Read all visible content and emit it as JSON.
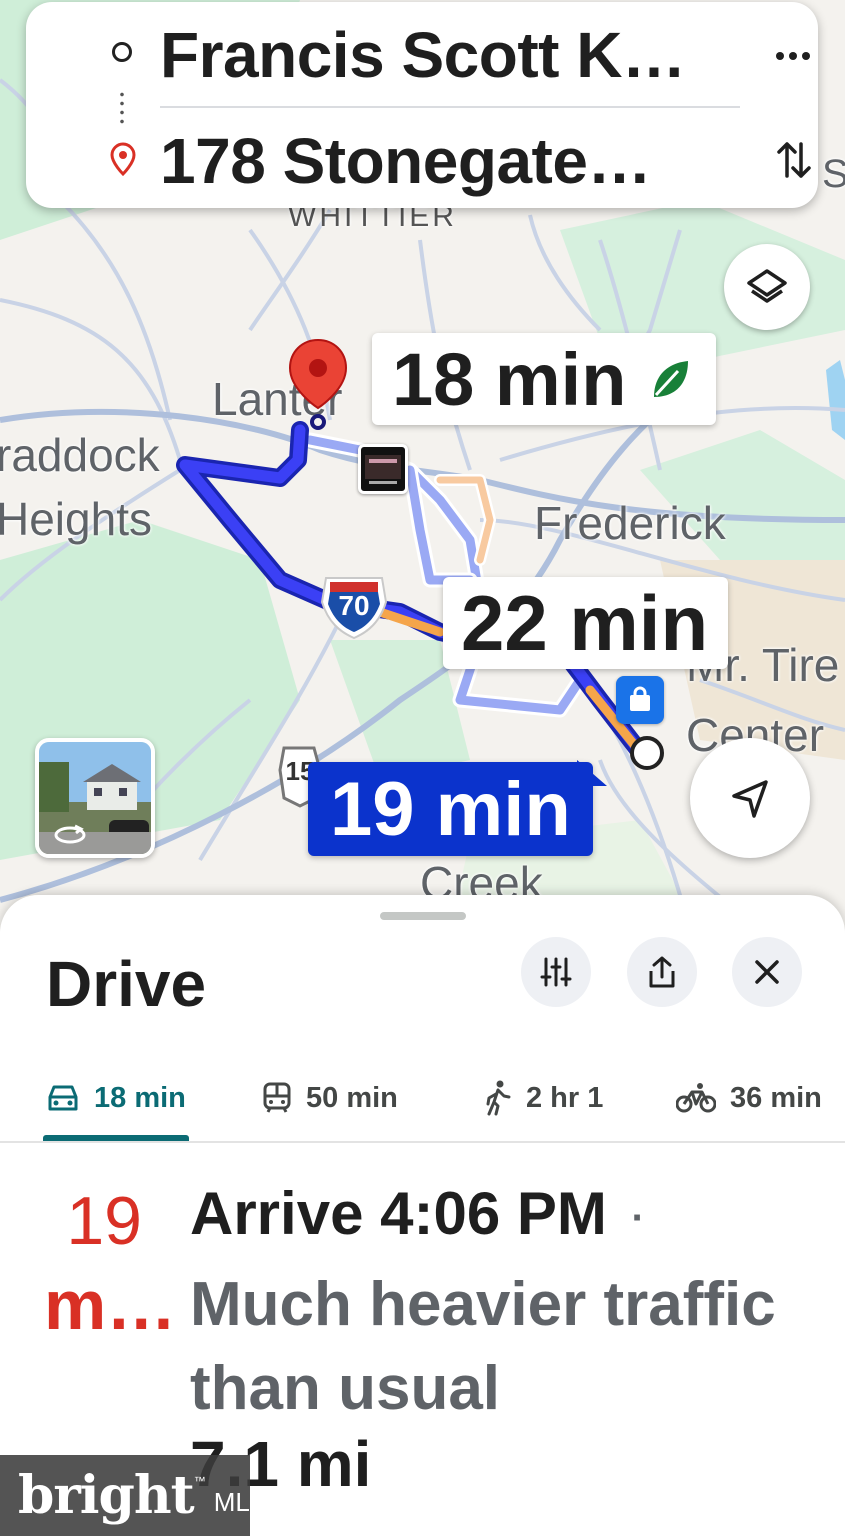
{
  "search": {
    "origin": "Francis Scott K…",
    "destination": "178 Stonegate…",
    "more_icon": "more-horiz-icon",
    "swap_icon": "swap-vert-icon"
  },
  "map": {
    "labels": {
      "whittier": "WHITTIER",
      "lantern": "Lanter",
      "braddock": "raddock",
      "heights": "Heights",
      "frederick": "Frederick",
      "mr_tire": "Mr. Tire",
      "center": "Center",
      "creek": "Creek",
      "edge_s": "S"
    },
    "shields": {
      "i70": "70",
      "us15": "15"
    },
    "route_times": {
      "best": "18 min",
      "alt1": "22 min",
      "selected": "19 min"
    },
    "colors": {
      "route_selected": "#2a36f0",
      "route_alt": "#9aa9f4",
      "traffic_slow": "#f5a54a",
      "label_selected_bg": "#0b33cc"
    }
  },
  "sheet": {
    "title": "Drive",
    "tabs": [
      {
        "icon": "car-icon",
        "label": "18 min"
      },
      {
        "icon": "transit-icon",
        "label": "50 min"
      },
      {
        "icon": "walk-icon",
        "label": "2 hr 1"
      },
      {
        "icon": "bike-icon",
        "label": "36 min"
      }
    ],
    "route": {
      "time_number": "19",
      "time_unit": "m…",
      "arrive": "Arrive 4:06 PM",
      "separator": "·",
      "traffic": "Much heavier traffic than usual",
      "distance": "7.1 mi"
    }
  },
  "watermark": {
    "brand": "bright",
    "tm": "™",
    "suffix": "MLS"
  }
}
